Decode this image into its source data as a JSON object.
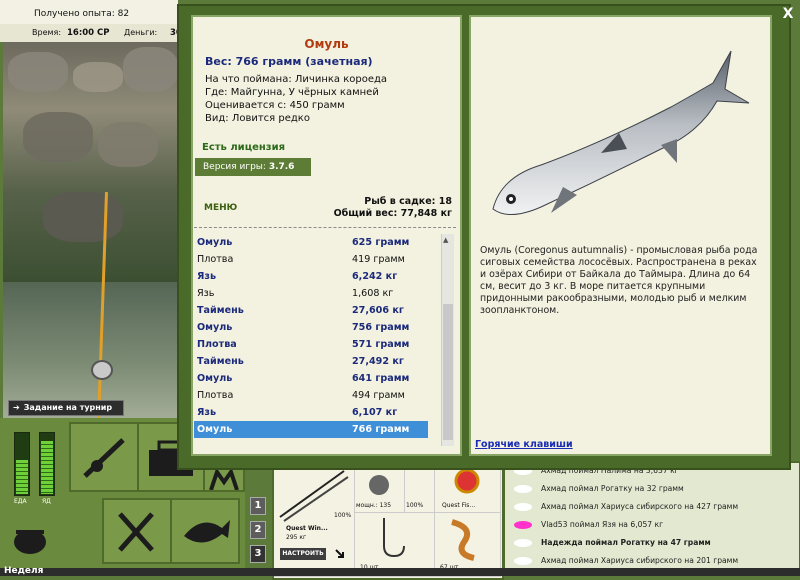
{
  "status": {
    "experience": "Получено опыта: 82",
    "time_label": "Время:",
    "time_value": "16:00 СР",
    "money_label": "Деньги:",
    "money_value": "30"
  },
  "tournament_button": "Задание на турнир",
  "meters": {
    "food_label": "ЕДА",
    "poison_label": "ЯД",
    "food_level": 0.55,
    "poison_level": 0.85
  },
  "number_buttons": [
    "1",
    "2",
    "3"
  ],
  "tackle": {
    "rod_name": "Quest Win...",
    "rod_weight": "295 кг",
    "rod_percent": "100%",
    "reel_power": "мощн.: 135",
    "reel_percent": "100%",
    "line_name": "Quest Fis...",
    "hook_count": "10 шт.",
    "bait_count": "67 шт.",
    "setup_button": "НАСТРОИТЬ"
  },
  "chat": [
    "Ахмад поймал Налима на 3,637 кг",
    "Ахмад поймал Рогатку на 32 грамм",
    "Ахмад поймал Хариуса сибирского на 427 грамм",
    "Vlad53 поймал Язя на 6,057 кг",
    "Надежда поймал Рогатку на 47 грамм",
    "Ахмад поймал Хариуса сибирского на 201 грамм"
  ],
  "bottom_text": "Неделя",
  "dialog": {
    "close": "X",
    "fish_name": "Омуль",
    "weight": "Вес: 766 грамм (зачетная)",
    "caught_on": "На что поймана: Личинка короеда",
    "where": "Где: Майгунна, У чёрных камней",
    "valued": "Оценивается с: 450 грамм",
    "kind": "Вид: Ловится редко",
    "license": "Есть лицензия",
    "version_label": "Версия игры:",
    "version": "3.7.6",
    "menu": "МЕНЮ",
    "keepnet": "Рыб в садке: 18",
    "total_weight": "Общий вес: 77,848 кг",
    "catch_list": [
      {
        "name": "Омуль",
        "weight": "625 грамм",
        "bold": true
      },
      {
        "name": "Плотва",
        "weight": "419 грамм",
        "bold": false
      },
      {
        "name": "Язь",
        "weight": "6,242 кг",
        "bold": true
      },
      {
        "name": "Язь",
        "weight": "1,608 кг",
        "bold": false
      },
      {
        "name": "Таймень",
        "weight": "27,606 кг",
        "bold": true
      },
      {
        "name": "Омуль",
        "weight": "756 грамм",
        "bold": true
      },
      {
        "name": "Плотва",
        "weight": "571 грамм",
        "bold": true
      },
      {
        "name": "Таймень",
        "weight": "27,492 кг",
        "bold": true
      },
      {
        "name": "Омуль",
        "weight": "641 грамм",
        "bold": true
      },
      {
        "name": "Плотва",
        "weight": "494 грамм",
        "bold": false
      },
      {
        "name": "Язь",
        "weight": "6,107 кг",
        "bold": true
      },
      {
        "name": "Омуль",
        "weight": "766 грамм",
        "bold": true,
        "selected": true
      }
    ],
    "description": "Омуль (Coregonus autumnalis) - промысловая рыба рода сиговых семейства лососёвых. Распространена в реках и озёрах Сибири от Байкала до Таймыра. Длина до 64 см, весит до 3 кг. В море питается крупными придонными ракообразными, молодью рыб и мелким зоопланктоном.",
    "hotkeys": "Горячие клавиши"
  }
}
